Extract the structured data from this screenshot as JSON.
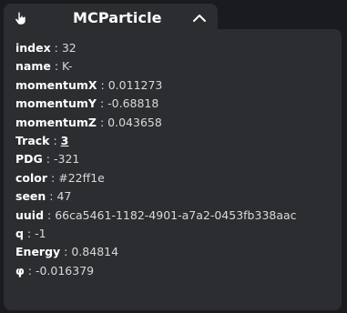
{
  "header": {
    "title": "MCParticle",
    "icon": "cursor-hand-icon",
    "collapse_icon": "chevron-up-icon"
  },
  "fields": [
    {
      "key": "index",
      "value": "32"
    },
    {
      "key": "name",
      "value": "K-"
    },
    {
      "key": "momentumX",
      "value": "0.011273"
    },
    {
      "key": "momentumY",
      "value": "-0.68818"
    },
    {
      "key": "momentumZ",
      "value": "0.043658"
    },
    {
      "key": "Track",
      "value": "3"
    },
    {
      "key": "PDG",
      "value": "-321"
    },
    {
      "key": "color",
      "value": "#22ff1e"
    },
    {
      "key": "seen",
      "value": "47"
    },
    {
      "key": "uuid",
      "value": "66ca5461-1182-4901-a7a2-0453fb338aac"
    },
    {
      "key": "q",
      "value": "-1"
    },
    {
      "key": "Energy",
      "value": "0.84814"
    },
    {
      "key": "φ",
      "value": "-0.016379"
    }
  ],
  "separator": " : ",
  "colors": {
    "background": "#1a1b1e",
    "panel": "#2c2d30",
    "text": "#d9d9db",
    "key_text": "#ffffff"
  }
}
